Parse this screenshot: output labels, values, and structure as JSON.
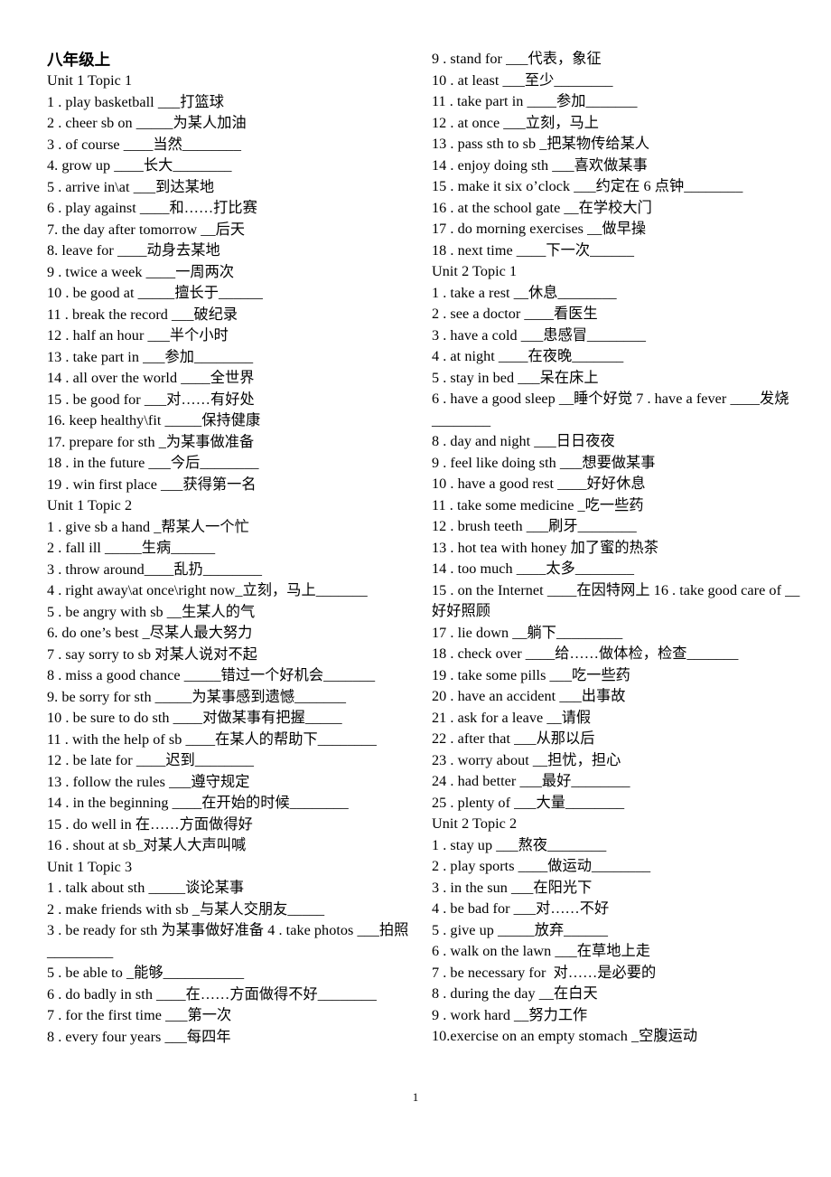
{
  "document": {
    "title": "八年级上",
    "page_number": "1"
  },
  "left_column": {
    "lines": [
      "八年级上",
      "Unit 1 Topic 1",
      "1 . play basketball ___打篮球",
      "2 . cheer sb on _____为某人加油",
      "3 . of course ____当然________",
      "4. grow up ____长大________",
      "5 . arrive in\\at ___到达某地",
      "6 . play against ____和……打比赛",
      "7. the day after tomorrow __后天",
      "8. leave for ____动身去某地",
      "9 . twice a week ____一周两次",
      "10 . be good at _____擅长于______",
      "11 . break the record ___破纪录",
      "12 . half an hour ___半个小时",
      "13 . take part in ___参加________",
      "14 . all over the world ____全世界",
      "15 . be good for ___对……有好处",
      "16. keep healthy\\fit _____保持健康",
      "17. prepare for sth _为某事做准备",
      "18 . in the future ___今后________",
      "19 . win first place ___获得第一名",
      "Unit 1 Topic 2",
      "1 . give sb a hand _帮某人一个忙",
      "2 . fall ill _____生病______",
      "3 . throw around____乱扔________",
      "4 . right away\\at once\\right now_立刻，马上_______",
      "5 . be angry with sb __生某人的气",
      "6. do one’s best _尽某人最大努力",
      "7 . say sorry to sb 对某人说对不起",
      "8 . miss a good chance _____错过一个好机会_______",
      "9. be sorry for sth _____为某事感到遗憾_______",
      "10 . be sure to do sth ____对做某事有把握_____",
      "11 . with the help of sb ____在某人的帮助下________",
      "12 . be late for ____迟到________",
      "13 . follow the rules ___遵守规定",
      "14 . in the beginning ____在开始的时候________",
      "15 . do well in 在……方面做得好",
      "16 . shout at sb_对某人大声叫喊",
      "Unit 1 Topic 3",
      "1 . talk about sth _____谈论某事",
      "2 . make friends with sb _与某人交朋友_____",
      "3 . be ready for sth 为某事做好准备 4 . take photos ___拍照_________",
      "5 . be able to _能够___________",
      "6 . do badly in sth ____在……方面做得不好________",
      "7 . for the first time ___第一次",
      "8 . every four years ___每四年"
    ]
  },
  "right_column": {
    "lines": [
      "9 . stand for ___代表，象征",
      "10 . at least ___至少________",
      "11 . take part in ____参加_______",
      "12 . at once ___立刻，马上",
      "13 . pass sth to sb _把某物传给某人",
      "14 . enjoy doing sth ___喜欢做某事",
      "15 . make it six o’clock ___约定在 6 点钟________",
      "16 . at the school gate __在学校大门",
      "17 . do morning exercises __做早操",
      "18 . next time ____下一次______",
      "Unit 2 Topic 1",
      "1 . take a rest __休息________",
      "2 . see a doctor ____看医生",
      "3 . have a cold ___患感冒________",
      "4 . at night ____在夜晚_______",
      "5 . stay in bed ___呆在床上",
      "6 . have a good sleep __睡个好觉 7 . have a fever ____发烧________",
      "8 . day and night ___日日夜夜",
      "9 . feel like doing sth ___想要做某事",
      "10 . have a good rest ____好好休息",
      "11 . take some medicine _吃一些药",
      "12 . brush teeth ___刷牙________",
      "13 . hot tea with honey 加了蜜的热茶",
      "14 . too much ____太多________",
      "15 . on the Internet ____在因特网上 16 . take good care of __好好照顾",
      "17 . lie down __躺下_________",
      "18 . check over ____给……做体检，检查_______",
      "19 . take some pills ___吃一些药",
      "20 . have an accident ___出事故",
      "21 . ask for a leave __请假",
      "22 . after that ___从那以后",
      "23 . worry about __担忧，担心",
      "24 . had better ___最好________",
      "25 . plenty of ___大量________",
      "Unit 2 Topic 2",
      "1 . stay up ___熬夜________",
      "2 . play sports ____做运动________",
      "3 . in the sun ___在阳光下",
      "4 . be bad for ___对……不好",
      "5 . give up _____放弃______",
      "6 . walk on the lawn ___在草地上走",
      "7 . be necessary for  对……是必要的",
      "8 . during the day __在白天",
      "9 . work hard __努力工作",
      "10.exercise on an empty stomach _空腹运动"
    ]
  }
}
